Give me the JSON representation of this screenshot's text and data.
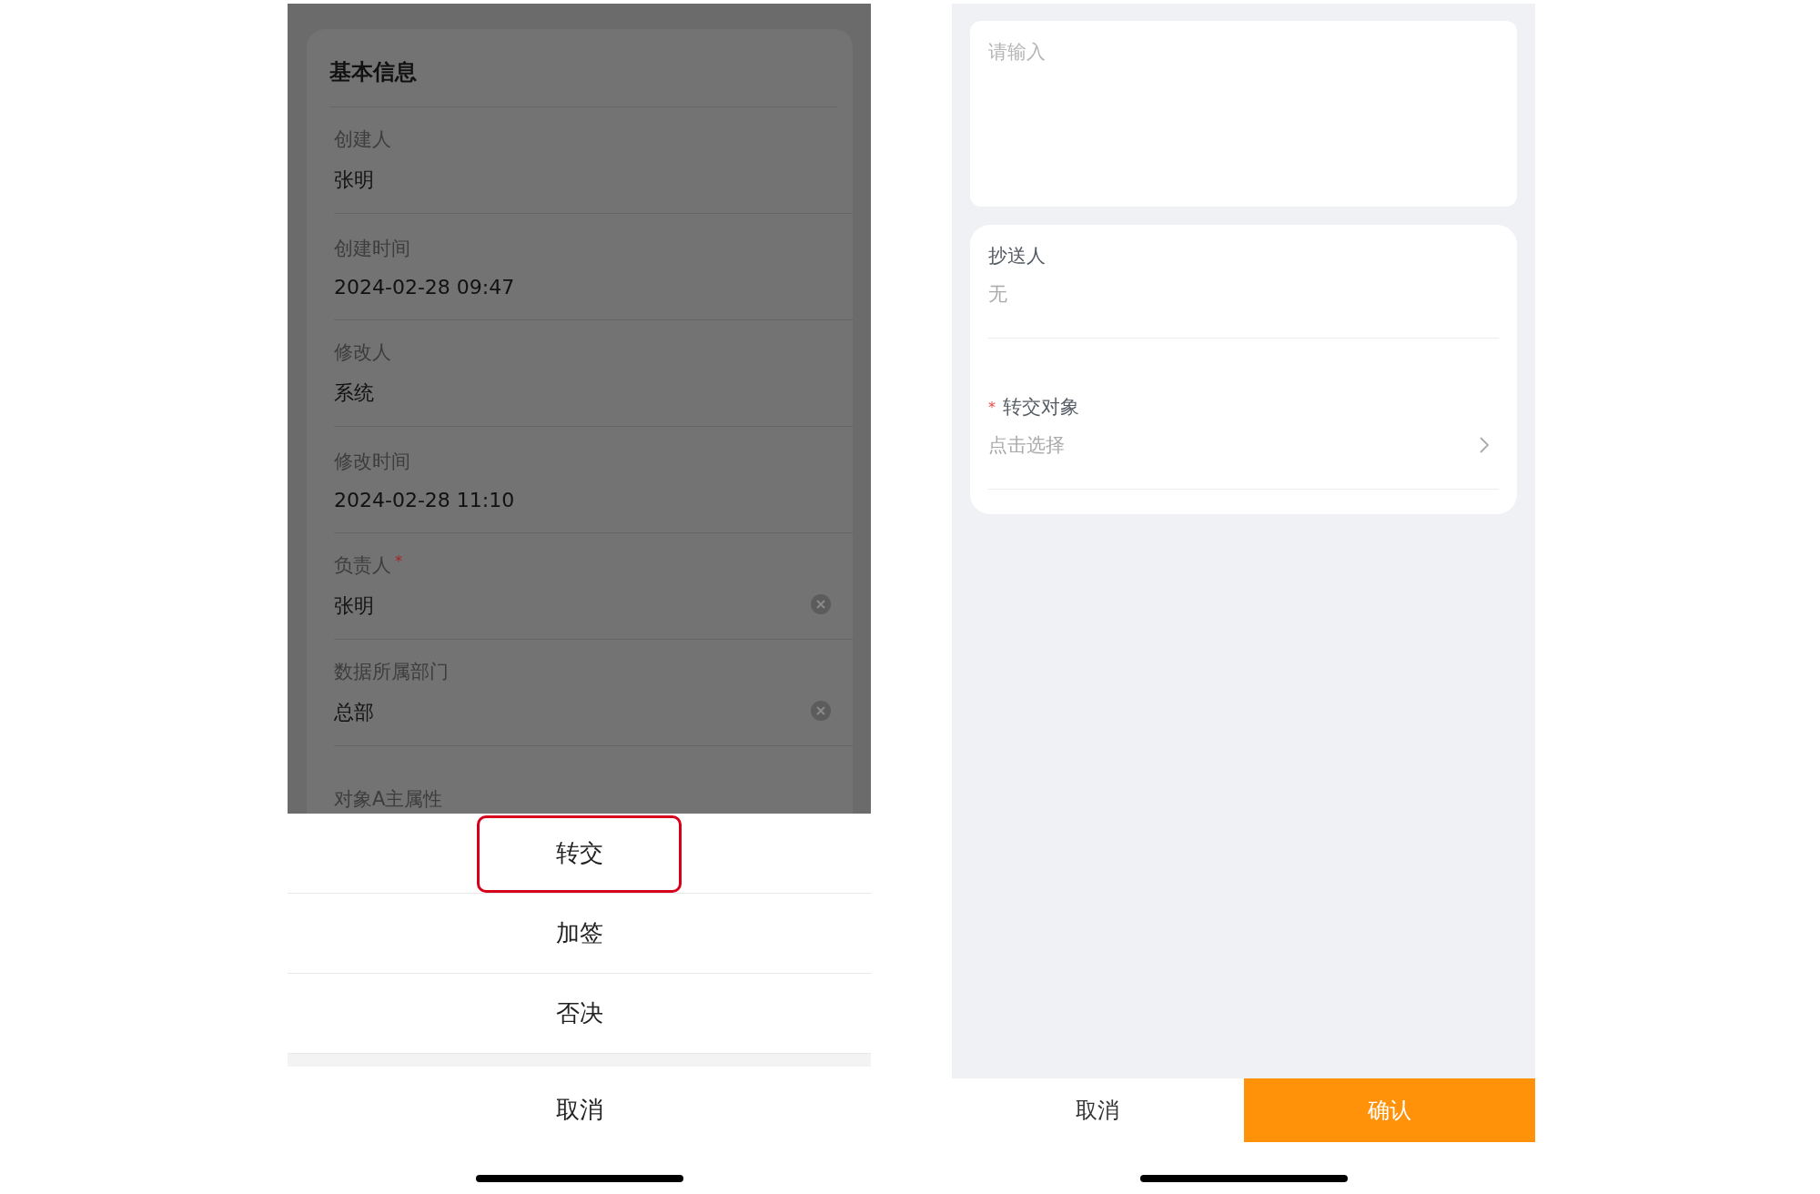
{
  "detail_screen": {
    "section_title": "基本信息",
    "fields": [
      {
        "label": "创建人",
        "value": "张明",
        "clearable": false
      },
      {
        "label": "创建时间",
        "value": "2024-02-28 09:47",
        "clearable": false
      },
      {
        "label": "修改人",
        "value": "系统",
        "clearable": false
      },
      {
        "label": "修改时间",
        "value": "2024-02-28 11:10",
        "clearable": false
      },
      {
        "label": "负责人",
        "required_mark": "*",
        "value": "张明",
        "clearable": true
      },
      {
        "label": "数据所属部门",
        "value": "总部",
        "clearable": true
      },
      {
        "label": "对象A主属性"
      }
    ]
  },
  "action_sheet": {
    "actions": [
      {
        "label": "转交",
        "highlighted": true
      },
      {
        "label": "加签",
        "highlighted": false
      },
      {
        "label": "否决",
        "highlighted": false
      }
    ],
    "cancel": "取消"
  },
  "transfer_screen": {
    "comment": {
      "placeholder": "请输入"
    },
    "fields": [
      {
        "kind": "text",
        "label": "抄送人",
        "value": "无"
      },
      {
        "kind": "picker",
        "required_mark": "*",
        "label": "转交对象",
        "placeholder": "点击选择"
      }
    ],
    "buttons": [
      {
        "label": "取消",
        "primary": false
      },
      {
        "label": "确认",
        "primary": true
      }
    ]
  }
}
